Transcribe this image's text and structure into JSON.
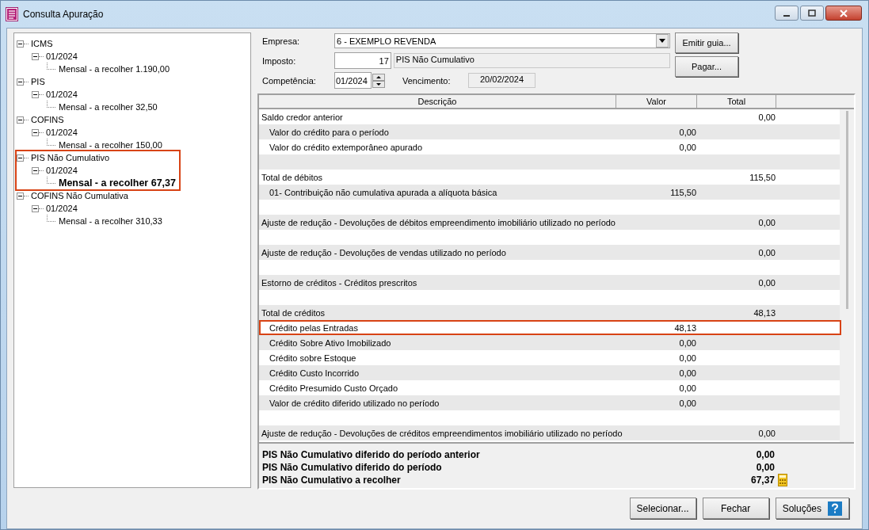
{
  "window": {
    "title": "Consulta Apuração"
  },
  "tree": [
    {
      "label": "ICMS",
      "expanded": true,
      "highlighted": false,
      "children": [
        {
          "label": "01/2024",
          "expanded": true,
          "children": [
            {
              "label": "Mensal - a recolher 1.190,00",
              "selected": false
            }
          ]
        }
      ]
    },
    {
      "label": "PIS",
      "expanded": true,
      "highlighted": false,
      "children": [
        {
          "label": "01/2024",
          "expanded": true,
          "children": [
            {
              "label": "Mensal - a recolher 32,50",
              "selected": false
            }
          ]
        }
      ]
    },
    {
      "label": "COFINS",
      "expanded": true,
      "highlighted": false,
      "children": [
        {
          "label": "01/2024",
          "expanded": true,
          "children": [
            {
              "label": "Mensal - a recolher 150,00",
              "selected": false
            }
          ]
        }
      ]
    },
    {
      "label": "PIS Não Cumulativo",
      "expanded": true,
      "highlighted": true,
      "children": [
        {
          "label": "01/2024",
          "expanded": true,
          "children": [
            {
              "label": "Mensal - a recolher 67,37",
              "selected": true
            }
          ]
        }
      ]
    },
    {
      "label": "COFINS Não Cumulativa",
      "expanded": true,
      "highlighted": false,
      "children": [
        {
          "label": "01/2024",
          "expanded": true,
          "children": [
            {
              "label": "Mensal - a recolher 310,33",
              "selected": false
            }
          ]
        }
      ]
    }
  ],
  "form": {
    "empresa": {
      "label": "Empresa:",
      "value": "6 - EXEMPLO REVENDA"
    },
    "imposto": {
      "label": "Imposto:",
      "code": "17",
      "name": "PIS Não Cumulativo"
    },
    "competencia": {
      "label": "Competência:",
      "value": "01/2024"
    },
    "vencimento": {
      "label": "Vencimento:",
      "value": "20/02/2024"
    }
  },
  "side_buttons": [
    "Emitir guia...",
    "Pagar..."
  ],
  "table": {
    "columns": [
      "Descrição",
      "Valor",
      "Total"
    ],
    "rows": [
      {
        "kind": "line",
        "indent": false,
        "description": "Saldo credor anterior",
        "total": "0,00",
        "highlighted": false
      },
      {
        "kind": "line",
        "indent": true,
        "description": "Valor do crédito para o período",
        "valor": "0,00",
        "highlighted": false
      },
      {
        "kind": "line",
        "indent": true,
        "description": "Valor do crédito extemporâneo apurado",
        "valor": "0,00",
        "highlighted": false
      },
      {
        "kind": "blank"
      },
      {
        "kind": "line",
        "indent": false,
        "description": "Total de débitos",
        "total": "115,50",
        "highlighted": false
      },
      {
        "kind": "line",
        "indent": true,
        "description": "01- Contribuição não cumulativa apurada a alíquota básica",
        "valor": "115,50",
        "highlighted": false
      },
      {
        "kind": "blank"
      },
      {
        "kind": "line",
        "indent": false,
        "description": "Ajuste de redução - Devoluções de débitos empreendimento imobiliário utilizado no período",
        "total": "0,00",
        "highlighted": false
      },
      {
        "kind": "blank"
      },
      {
        "kind": "line",
        "indent": false,
        "description": "Ajuste de redução - Devoluções de vendas utilizado no período",
        "total": "0,00",
        "highlighted": false
      },
      {
        "kind": "blank"
      },
      {
        "kind": "line",
        "indent": false,
        "description": "Estorno de créditos - Créditos prescritos",
        "total": "0,00",
        "highlighted": false
      },
      {
        "kind": "blank"
      },
      {
        "kind": "line",
        "indent": false,
        "description": "Total de créditos",
        "total": "48,13",
        "highlighted": false
      },
      {
        "kind": "line",
        "indent": true,
        "description": "Crédito pelas Entradas",
        "valor": "48,13",
        "highlighted": true
      },
      {
        "kind": "line",
        "indent": true,
        "description": "Crédito Sobre Ativo Imobilizado",
        "valor": "0,00",
        "highlighted": false
      },
      {
        "kind": "line",
        "indent": true,
        "description": "Crédito sobre Estoque",
        "valor": "0,00",
        "highlighted": false
      },
      {
        "kind": "line",
        "indent": true,
        "description": "Crédito Custo Incorrido",
        "valor": "0,00",
        "highlighted": false
      },
      {
        "kind": "line",
        "indent": true,
        "description": "Crédito Presumido Custo Orçado",
        "valor": "0,00",
        "highlighted": false
      },
      {
        "kind": "line",
        "indent": true,
        "description": "Valor de crédito diferido utilizado no período",
        "valor": "0,00",
        "highlighted": false
      },
      {
        "kind": "blank"
      },
      {
        "kind": "line",
        "indent": false,
        "description": "Ajuste de redução - Devoluções de créditos empreendimentos imobiliário utilizado no período",
        "total": "0,00",
        "highlighted": false
      }
    ]
  },
  "summary": [
    {
      "label": "PIS Não Cumulativo diferido do período anterior",
      "value": "0,00",
      "calculator": false
    },
    {
      "label": "PIS Não Cumulativo diferido do período",
      "value": "0,00",
      "calculator": false
    },
    {
      "label": "PIS Não Cumulativo a recolher",
      "value": "67,37",
      "calculator": true
    }
  ],
  "buttons": [
    {
      "label": "Selecionar...",
      "help": false
    },
    {
      "label": "Fechar",
      "help": false
    },
    {
      "label": "Soluções",
      "help": true
    }
  ]
}
